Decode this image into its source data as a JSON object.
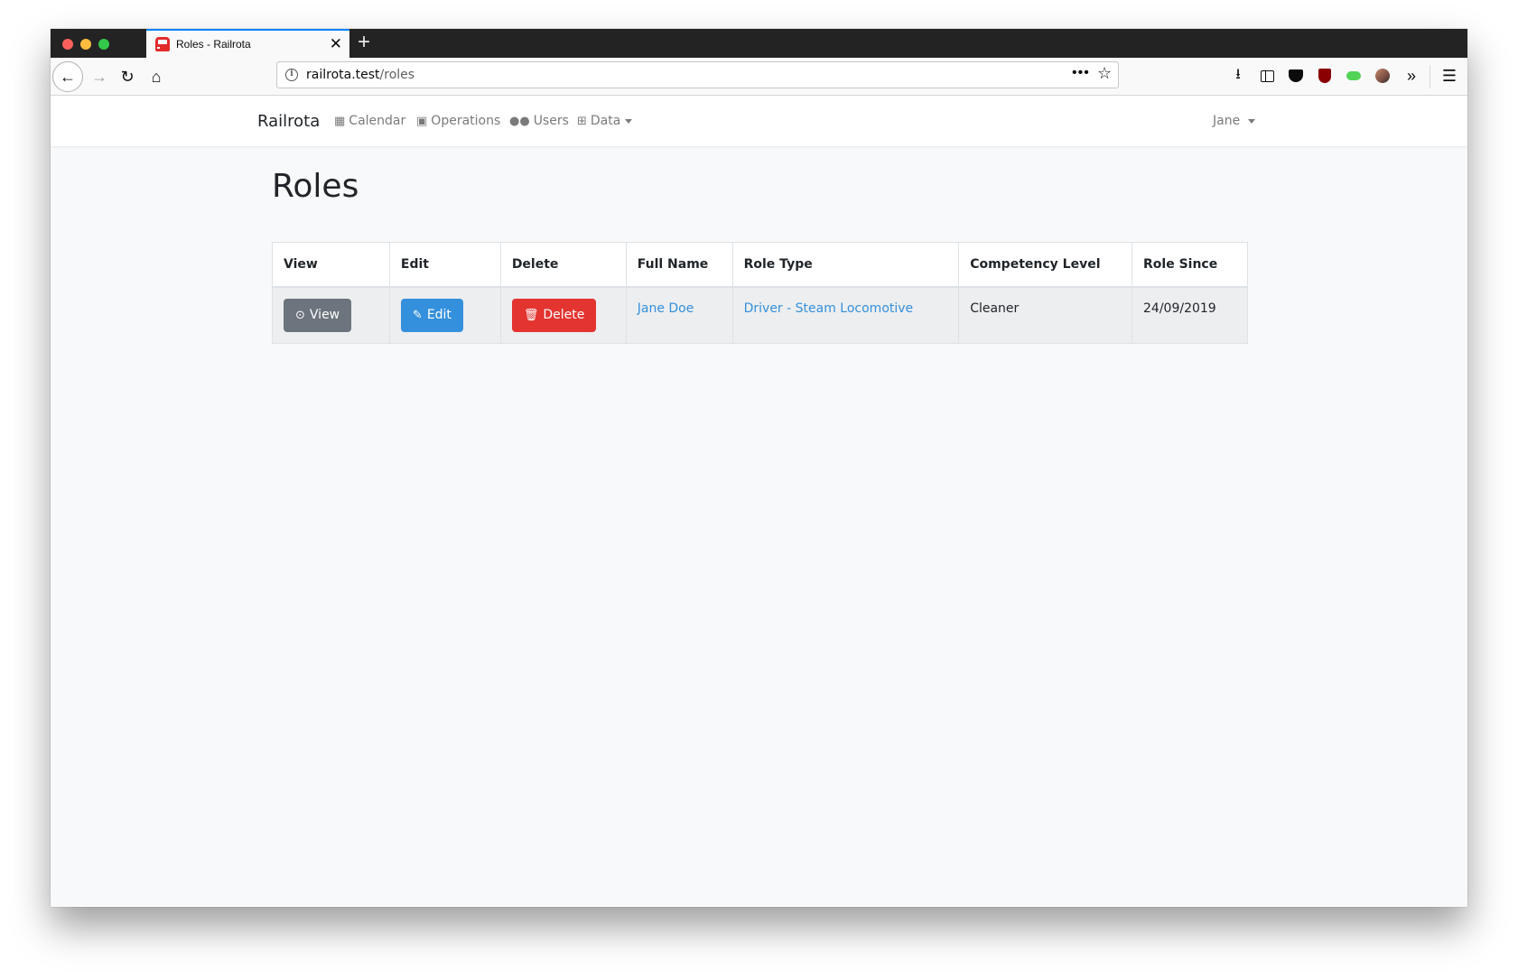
{
  "browser": {
    "tab_title": "Roles - Railrota",
    "url_host": "railrota.test",
    "url_path": "/roles"
  },
  "navbar": {
    "brand": "Railrota",
    "links": [
      {
        "label": "Calendar",
        "icon": "calendar-icon"
      },
      {
        "label": "Operations",
        "icon": "train-icon"
      },
      {
        "label": "Users",
        "icon": "users-icon"
      },
      {
        "label": "Data",
        "icon": "table-icon"
      }
    ],
    "user": "Jane"
  },
  "page": {
    "title": "Roles"
  },
  "table": {
    "headers": [
      "View",
      "Edit",
      "Delete",
      "Full Name",
      "Role Type",
      "Competency Level",
      "Role Since"
    ],
    "rows": [
      {
        "view_label": "View",
        "edit_label": "Edit",
        "delete_label": "Delete",
        "full_name": "Jane Doe",
        "role_type": "Driver - Steam Locomotive",
        "competency_level": "Cleaner",
        "role_since": "24/09/2019"
      }
    ]
  },
  "colors": {
    "primary": "#3490dc",
    "danger": "#e3342f",
    "secondary": "#6c757d"
  }
}
